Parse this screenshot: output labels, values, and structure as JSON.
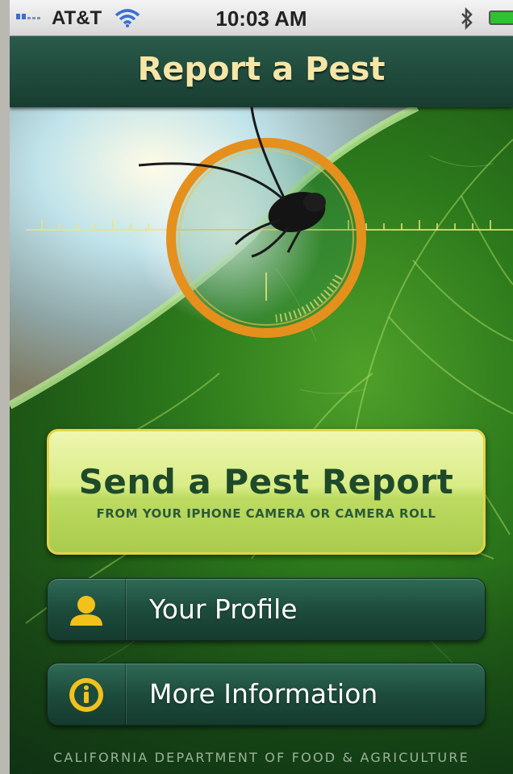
{
  "status_bar": {
    "carrier": "AT&T",
    "time": "10:03 AM"
  },
  "nav": {
    "title": "Report a Pest"
  },
  "main_button": {
    "title": "Send a Pest Report",
    "subtitle": "FROM YOUR IPHONE CAMERA OR CAMERA ROLL"
  },
  "menu": [
    {
      "label": "Your Profile",
      "icon": "person-icon"
    },
    {
      "label": "More Information",
      "icon": "info-icon"
    }
  ],
  "footer": "CALIFORNIA DEPARTMENT OF FOOD & AGRICULTURE",
  "colors": {
    "title_gold": "#f5e6a8",
    "nav_green": "#1f4a3a",
    "button_yellow_green": "#d9ec86",
    "icon_yellow": "#f2c21a"
  }
}
